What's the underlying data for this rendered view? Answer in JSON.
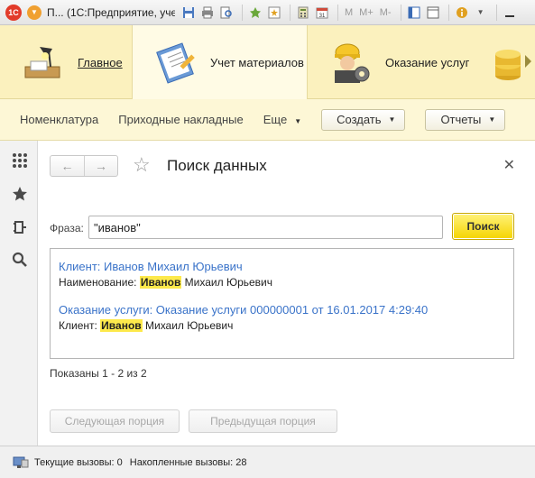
{
  "titlebar": {
    "app_badge": "1С",
    "title": "П... (1С:Предприятие, учеб...",
    "text_buttons": [
      "M",
      "M+",
      "M-"
    ]
  },
  "sections": [
    {
      "label": "Главное",
      "icon": "desk-lamp-icon",
      "active": false,
      "link": true
    },
    {
      "label": "Учет материалов",
      "icon": "clipboard-pencil-icon",
      "active": true,
      "link": false
    },
    {
      "label": "Оказание услуг",
      "icon": "worker-gear-icon",
      "active": false,
      "link": false
    }
  ],
  "commands": {
    "items": [
      "Номенклатура",
      "Приходные накладные"
    ],
    "more": "Еще",
    "create": "Создать",
    "reports": "Отчеты"
  },
  "toolstrip": [
    "apps-grid-icon",
    "favorites-star-icon",
    "history-icon",
    "search-icon"
  ],
  "form": {
    "title": "Поиск данных",
    "phrase_label": "Фраза:",
    "phrase_value": "\"иванов\"",
    "search_button": "Поиск",
    "results": [
      {
        "title": "Клиент: Иванов Михаил Юрьевич",
        "detail_prefix": "Наименование: ",
        "detail_highlight": "Иванов",
        "detail_suffix": " Михаил Юрьевич"
      },
      {
        "title": "Оказание услуги: Оказание услуги 000000001 от 16.01.2017 4:29:40",
        "detail_prefix": "Клиент: ",
        "detail_highlight": "Иванов",
        "detail_suffix": " Михаил Юрьевич"
      }
    ],
    "shown_text": "Показаны 1 - 2 из 2",
    "next_portion": "Следующая порция",
    "prev_portion": "Предыдущая порция"
  },
  "status": {
    "current_calls": "Текущие вызовы: 0",
    "accumulated_calls": "Накопленные вызовы: 28"
  },
  "colors": {
    "sections_bg": "#fbf1be",
    "command_bg": "#fdf7d6",
    "link_blue": "#3a73c9",
    "search_yellow": "#f5d400",
    "highlight": "#fde94b"
  }
}
